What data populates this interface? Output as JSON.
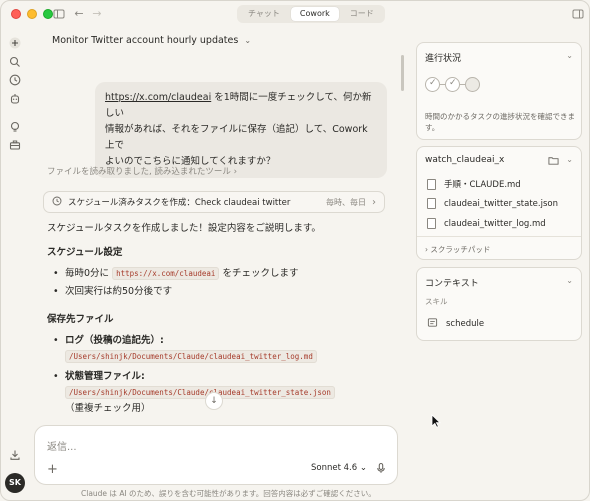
{
  "titlebar": {
    "tabs": [
      "チャット",
      "Cowork",
      "コード"
    ],
    "active_tab": "Cowork"
  },
  "rail": {
    "icons": [
      "plus-icon",
      "search-icon",
      "clock-icon",
      "dispatch-icon",
      "lightbulb-icon",
      "briefcase-icon",
      "download-icon"
    ],
    "avatar": "SK"
  },
  "conversation": {
    "title": "Monitor Twitter account hourly updates",
    "user_message_link": "https://x.com/claudeai",
    "user_message_line1_rest": " を1時間に一度チェックして、何か新しい",
    "user_message_line2": "情報があれば、それをファイルに保存（追記）して、Cowork上で",
    "user_message_line3": "よいのでこちらに通知してくれますか？",
    "tools_read": "ファイルを読み取りました, 読み込まれたツール",
    "task_card": {
      "label": "スケジュール済みタスクを作成：Check claudeai twitter",
      "schedule": "毎時、毎日"
    },
    "response": {
      "intro": "スケジュールタスクを作成しました！設定内容をご説明します。",
      "schedule_heading": "スケジュール設定",
      "schedule_item1_pre": "毎時0分に ",
      "schedule_item1_code": "https://x.com/claudeai",
      "schedule_item1_post": " をチェックします",
      "schedule_item2": "次回実行は約50分後です",
      "files_heading": "保存先ファイル",
      "file1_label": "ログ（投稿の追記先）:",
      "file1_path": "/Users/shinjk/Documents/Claude/claudeai_twitter_log.md",
      "file2_label": "状態管理ファイル:",
      "file2_path": "/Users/shinjk/Documents/Claude/claudeai_twitter_state.json",
      "file2_note": "（重複チェック用）"
    }
  },
  "composer": {
    "placeholder": "返信...",
    "model": "Sonnet 4.6",
    "disclaimer": "Claude は AI のため、誤りを含む可能性があります。回答内容は必ずご確認ください。"
  },
  "panels": {
    "progress": {
      "title": "進行状況",
      "steps": [
        "done",
        "done",
        "pending"
      ],
      "desc": "時間のかかるタスクの進捗状況を確認できます。"
    },
    "folder": {
      "title": "watch_claudeai_x",
      "files": [
        "手順・CLAUDE.md",
        "claudeai_twitter_state.json",
        "claudeai_twitter_log.md"
      ],
      "scratchpad": "スクラッチパッド"
    },
    "context": {
      "title": "コンテキスト",
      "skills_label": "スキル",
      "skill": "schedule"
    }
  }
}
